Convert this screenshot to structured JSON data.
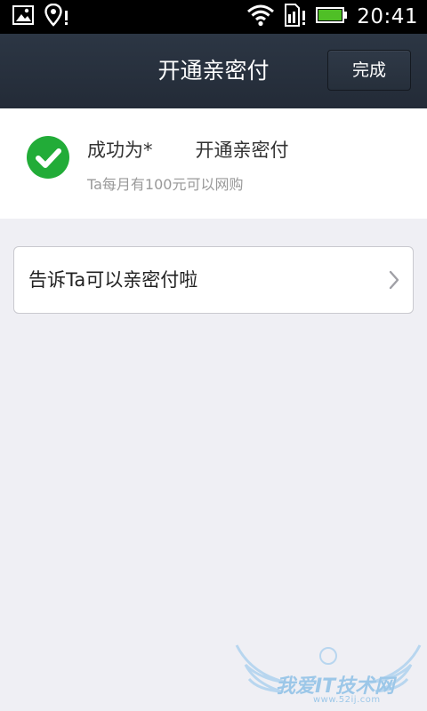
{
  "status_bar": {
    "time": "20:41",
    "icons": [
      "gallery-notification-icon",
      "location-alert-icon",
      "wifi-icon",
      "sim-alert-icon",
      "battery-icon"
    ]
  },
  "nav": {
    "title": "开通亲密付",
    "done_label": "完成"
  },
  "success": {
    "prefix": "成功为*",
    "suffix": "开通亲密付",
    "subtitle": "Ta每月有100元可以网购",
    "icon": "check-circle-icon",
    "color": "#22ac38"
  },
  "tell_card": {
    "label": "告诉Ta可以亲密付啦",
    "icon": "chevron-right-icon"
  },
  "watermark": {
    "text": "我爱IT技术网",
    "url": "www.52ij.com"
  },
  "colors": {
    "nav_background": "#262f3b",
    "page_background": "#efeff4",
    "accent_green": "#22ac38"
  }
}
